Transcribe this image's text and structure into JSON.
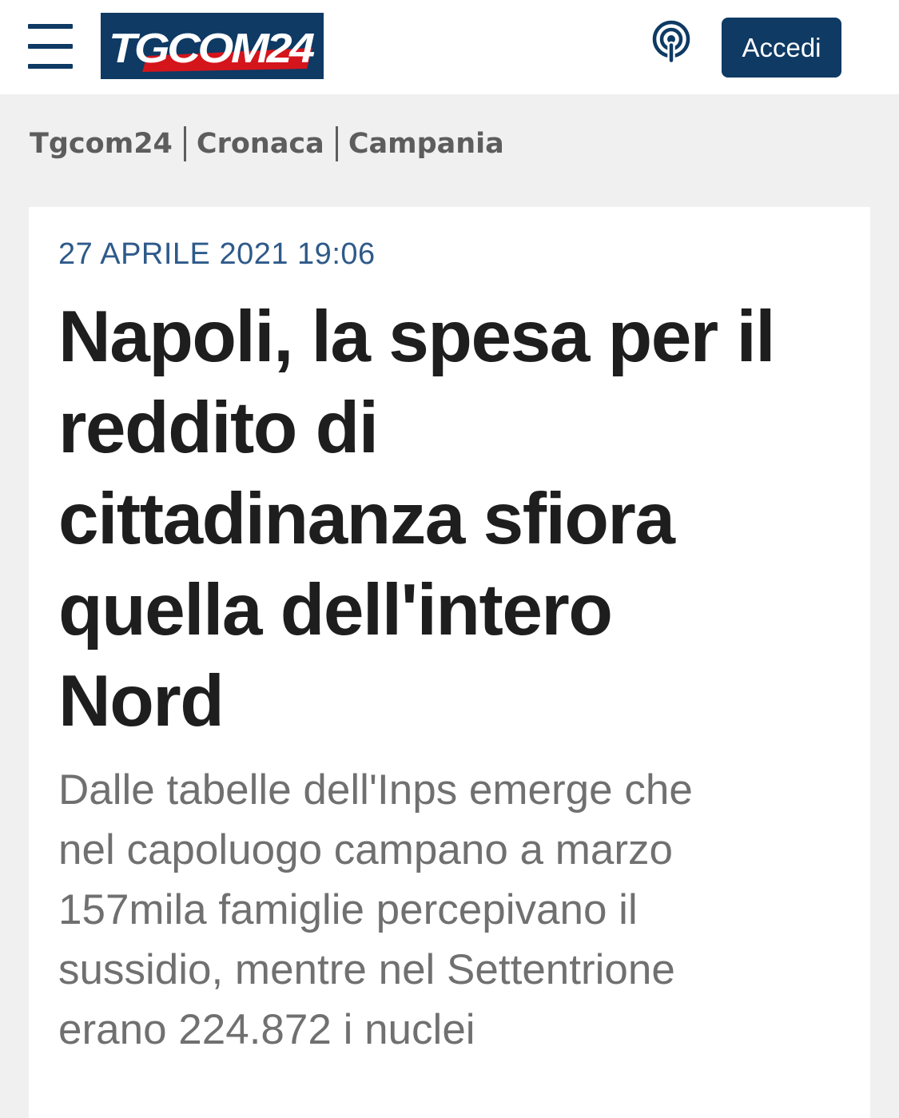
{
  "header": {
    "logo_text": "TGCOM24",
    "login_label": "Accedi",
    "menu_icon": "hamburger-menu-icon",
    "podcast_icon": "podcast-icon",
    "colors": {
      "header_bg": "#ffffff",
      "brand_blue": "#0e3a64",
      "logo_red": "#d4151c"
    }
  },
  "breadcrumb": {
    "items": [
      "Tgcom24",
      "Cronaca",
      "Campania"
    ]
  },
  "article": {
    "date": "27 APRILE 2021 19:06",
    "headline_lines": [
      "Napoli, la spesa per il",
      "reddito di",
      "cittadinanza sfiora",
      "quella dell'intero",
      "Nord"
    ],
    "summary_lines": [
      "Dalle tabelle dell'Inps emerge che",
      "nel capoluogo campano a marzo",
      "157mila famiglie percepivano il",
      "sussidio, mentre nel Settentrione",
      "erano 224.872 i nuclei"
    ]
  }
}
